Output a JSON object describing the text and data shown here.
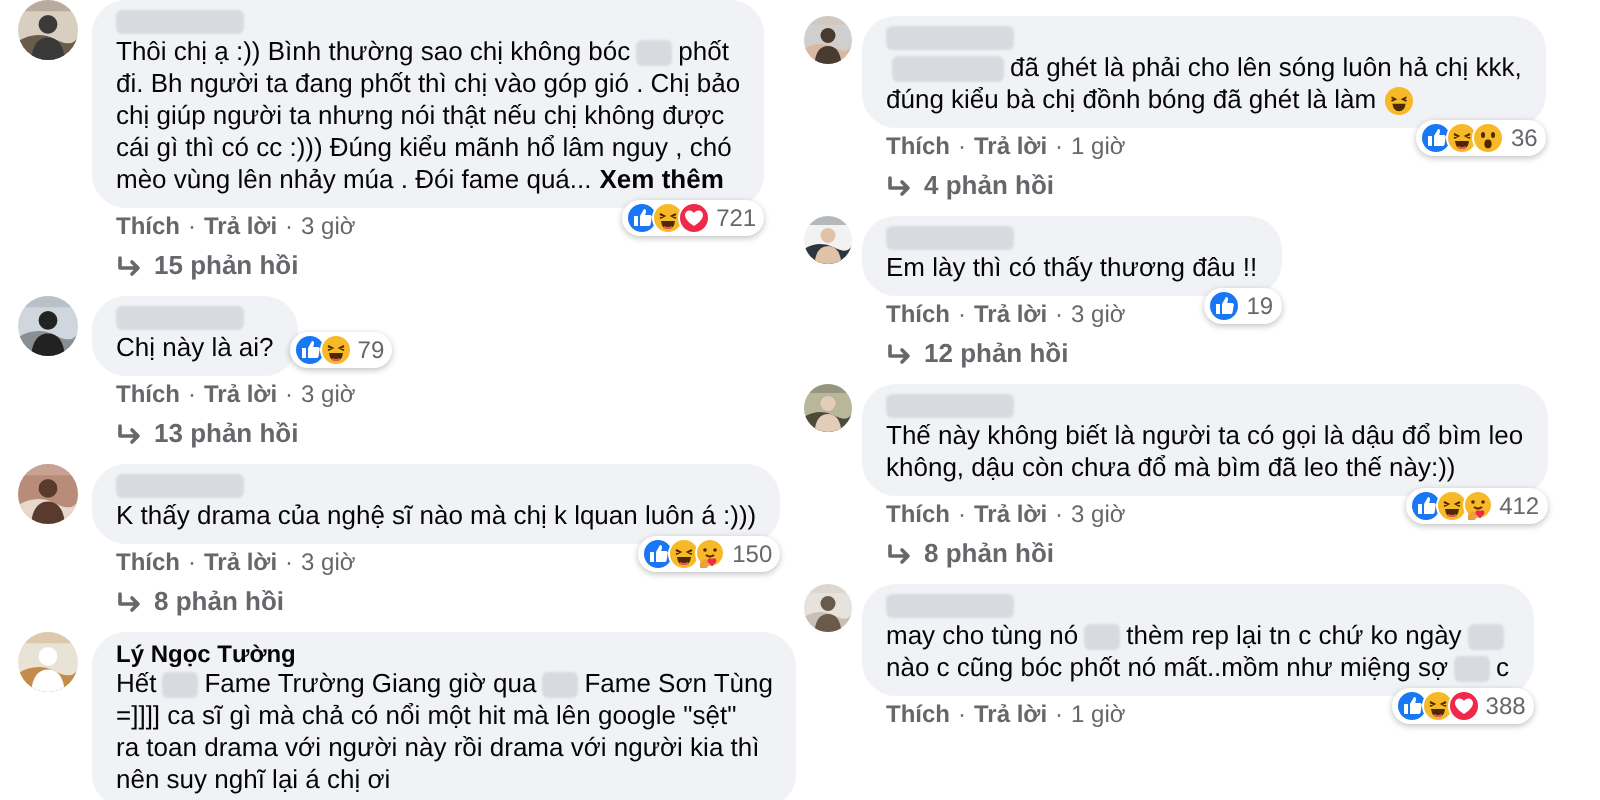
{
  "columns": [
    {
      "comments": [
        {
          "name": {
            "kind": "blur"
          },
          "lines": [
            [
              {
                "kind": "text",
                "text": "Thôi chị ạ :)) Bình thường sao chị không bóc"
              },
              {
                "kind": "blur"
              },
              {
                "kind": "text",
                "text": "phốt"
              }
            ],
            [
              {
                "kind": "text",
                "text": "đi. Bh người ta đang phốt thì chị vào góp gió . Chị bảo"
              }
            ],
            [
              {
                "kind": "text",
                "text": "chị giúp người ta nhưng nói thật nếu chị không được"
              }
            ],
            [
              {
                "kind": "text",
                "text": "cái gì thì có cc :))) Đúng kiểu mãnh hổ lâm nguy , chó"
              }
            ],
            [
              {
                "kind": "text",
                "text": "mèo vùng lên nhảy múa . Đói fame quá..."
              },
              {
                "kind": "more",
                "text": "Xem thêm"
              }
            ]
          ],
          "reactions": {
            "icons": [
              {
                "kind": "like"
              },
              {
                "kind": "haha"
              },
              {
                "kind": "love"
              }
            ],
            "count": "721"
          },
          "actions": {
            "like": "Thích",
            "reply": "Trả lời",
            "separator": "·",
            "time": "3 giờ"
          },
          "replies": "15 phản hồi"
        },
        {
          "name": {
            "kind": "blur"
          },
          "lines": [
            [
              {
                "kind": "text",
                "text": "Chị này là ai?"
              }
            ]
          ],
          "reactions": {
            "icons": [
              {
                "kind": "like"
              },
              {
                "kind": "haha"
              }
            ],
            "count": "79"
          },
          "actions": {
            "like": "Thích",
            "reply": "Trả lời",
            "separator": "·",
            "time": "3 giờ"
          },
          "replies": "13 phản hồi"
        },
        {
          "name": {
            "kind": "blur"
          },
          "lines": [
            [
              {
                "kind": "text",
                "text": "K thấy drama của nghệ sĩ nào mà chị k lquan luôn á :)))"
              }
            ]
          ],
          "reactions": {
            "icons": [
              {
                "kind": "like"
              },
              {
                "kind": "haha"
              },
              {
                "kind": "care"
              }
            ],
            "count": "150"
          },
          "actions": {
            "like": "Thích",
            "reply": "Trả lời",
            "separator": "·",
            "time": "3 giờ"
          },
          "replies": "8 phản hồi"
        },
        {
          "name": {
            "kind": "text",
            "text": "Lý Ngọc Tường"
          },
          "lines": [
            [
              {
                "kind": "text",
                "text": "Hết"
              },
              {
                "kind": "blur"
              },
              {
                "kind": "text",
                "text": "Fame Trường Giang giờ qua"
              },
              {
                "kind": "blur"
              },
              {
                "kind": "text",
                "text": "Fame Sơn Tùng"
              }
            ],
            [
              {
                "kind": "text",
                "text": "=]]]] ca sĩ gì mà chả có nổi một hit mà lên google \"sệt\""
              }
            ],
            [
              {
                "kind": "text",
                "text": "ra toan drama với người này rồi drama với người kia thì"
              }
            ],
            [
              {
                "kind": "text",
                "text": "nên suy nghĩ lại á chị ơi"
              }
            ]
          ]
        }
      ]
    },
    {
      "comments": [
        {
          "name": {
            "kind": "blur"
          },
          "lines": [
            [
              {
                "kind": "blur"
              },
              {
                "kind": "text",
                "text": "đã ghét là phải cho lên sóng luôn hả chị kkk,"
              }
            ],
            [
              {
                "kind": "text",
                "text": "đúng kiểu bà chị đồnh bóng đã ghét là làm"
              },
              {
                "kind": "laugh_emoji"
              }
            ]
          ],
          "reactions": {
            "icons": [
              {
                "kind": "like"
              },
              {
                "kind": "haha"
              },
              {
                "kind": "wow"
              }
            ],
            "count": "36"
          },
          "actions": {
            "like": "Thích",
            "reply": "Trả lời",
            "separator": "·",
            "time": "1 giờ"
          },
          "replies": "4 phản hồi"
        },
        {
          "name": {
            "kind": "blur"
          },
          "lines": [
            [
              {
                "kind": "text",
                "text": "Em lày thì có thấy thương đâu !!"
              }
            ]
          ],
          "reactions": {
            "icons": [
              {
                "kind": "like"
              }
            ],
            "count": "19"
          },
          "actions": {
            "like": "Thích",
            "reply": "Trả lời",
            "separator": "·",
            "time": "3 giờ"
          },
          "replies": "12 phản hồi"
        },
        {
          "name": {
            "kind": "blur"
          },
          "lines": [
            [
              {
                "kind": "text",
                "text": "Thế này không biết là người ta có gọi là dậu đổ bìm leo"
              }
            ],
            [
              {
                "kind": "text",
                "text": "không, dậu còn chưa đổ mà bìm đã leo thế này:))"
              }
            ]
          ],
          "reactions": {
            "icons": [
              {
                "kind": "like"
              },
              {
                "kind": "haha"
              },
              {
                "kind": "care"
              }
            ],
            "count": "412"
          },
          "actions": {
            "like": "Thích",
            "reply": "Trả lời",
            "separator": "·",
            "time": "3 giờ"
          },
          "replies": "8 phản hồi"
        },
        {
          "name": {
            "kind": "blur"
          },
          "lines": [
            [
              {
                "kind": "text",
                "text": "may cho tùng nó"
              },
              {
                "kind": "blur"
              },
              {
                "kind": "text",
                "text": "thèm rep lại tn c chứ ko ngày"
              },
              {
                "kind": "blur"
              }
            ],
            [
              {
                "kind": "text",
                "text": "nào c cũng bóc phốt nó mất..mồm như miệng sợ"
              },
              {
                "kind": "blur"
              },
              {
                "kind": "text",
                "text": "c"
              }
            ]
          ],
          "reactions": {
            "icons": [
              {
                "kind": "like"
              },
              {
                "kind": "haha"
              },
              {
                "kind": "love"
              }
            ],
            "count": "388"
          },
          "actions": {
            "like": "Thích",
            "reply": "Trả lời",
            "separator": "·",
            "time": "1 giờ"
          }
        }
      ]
    }
  ]
}
